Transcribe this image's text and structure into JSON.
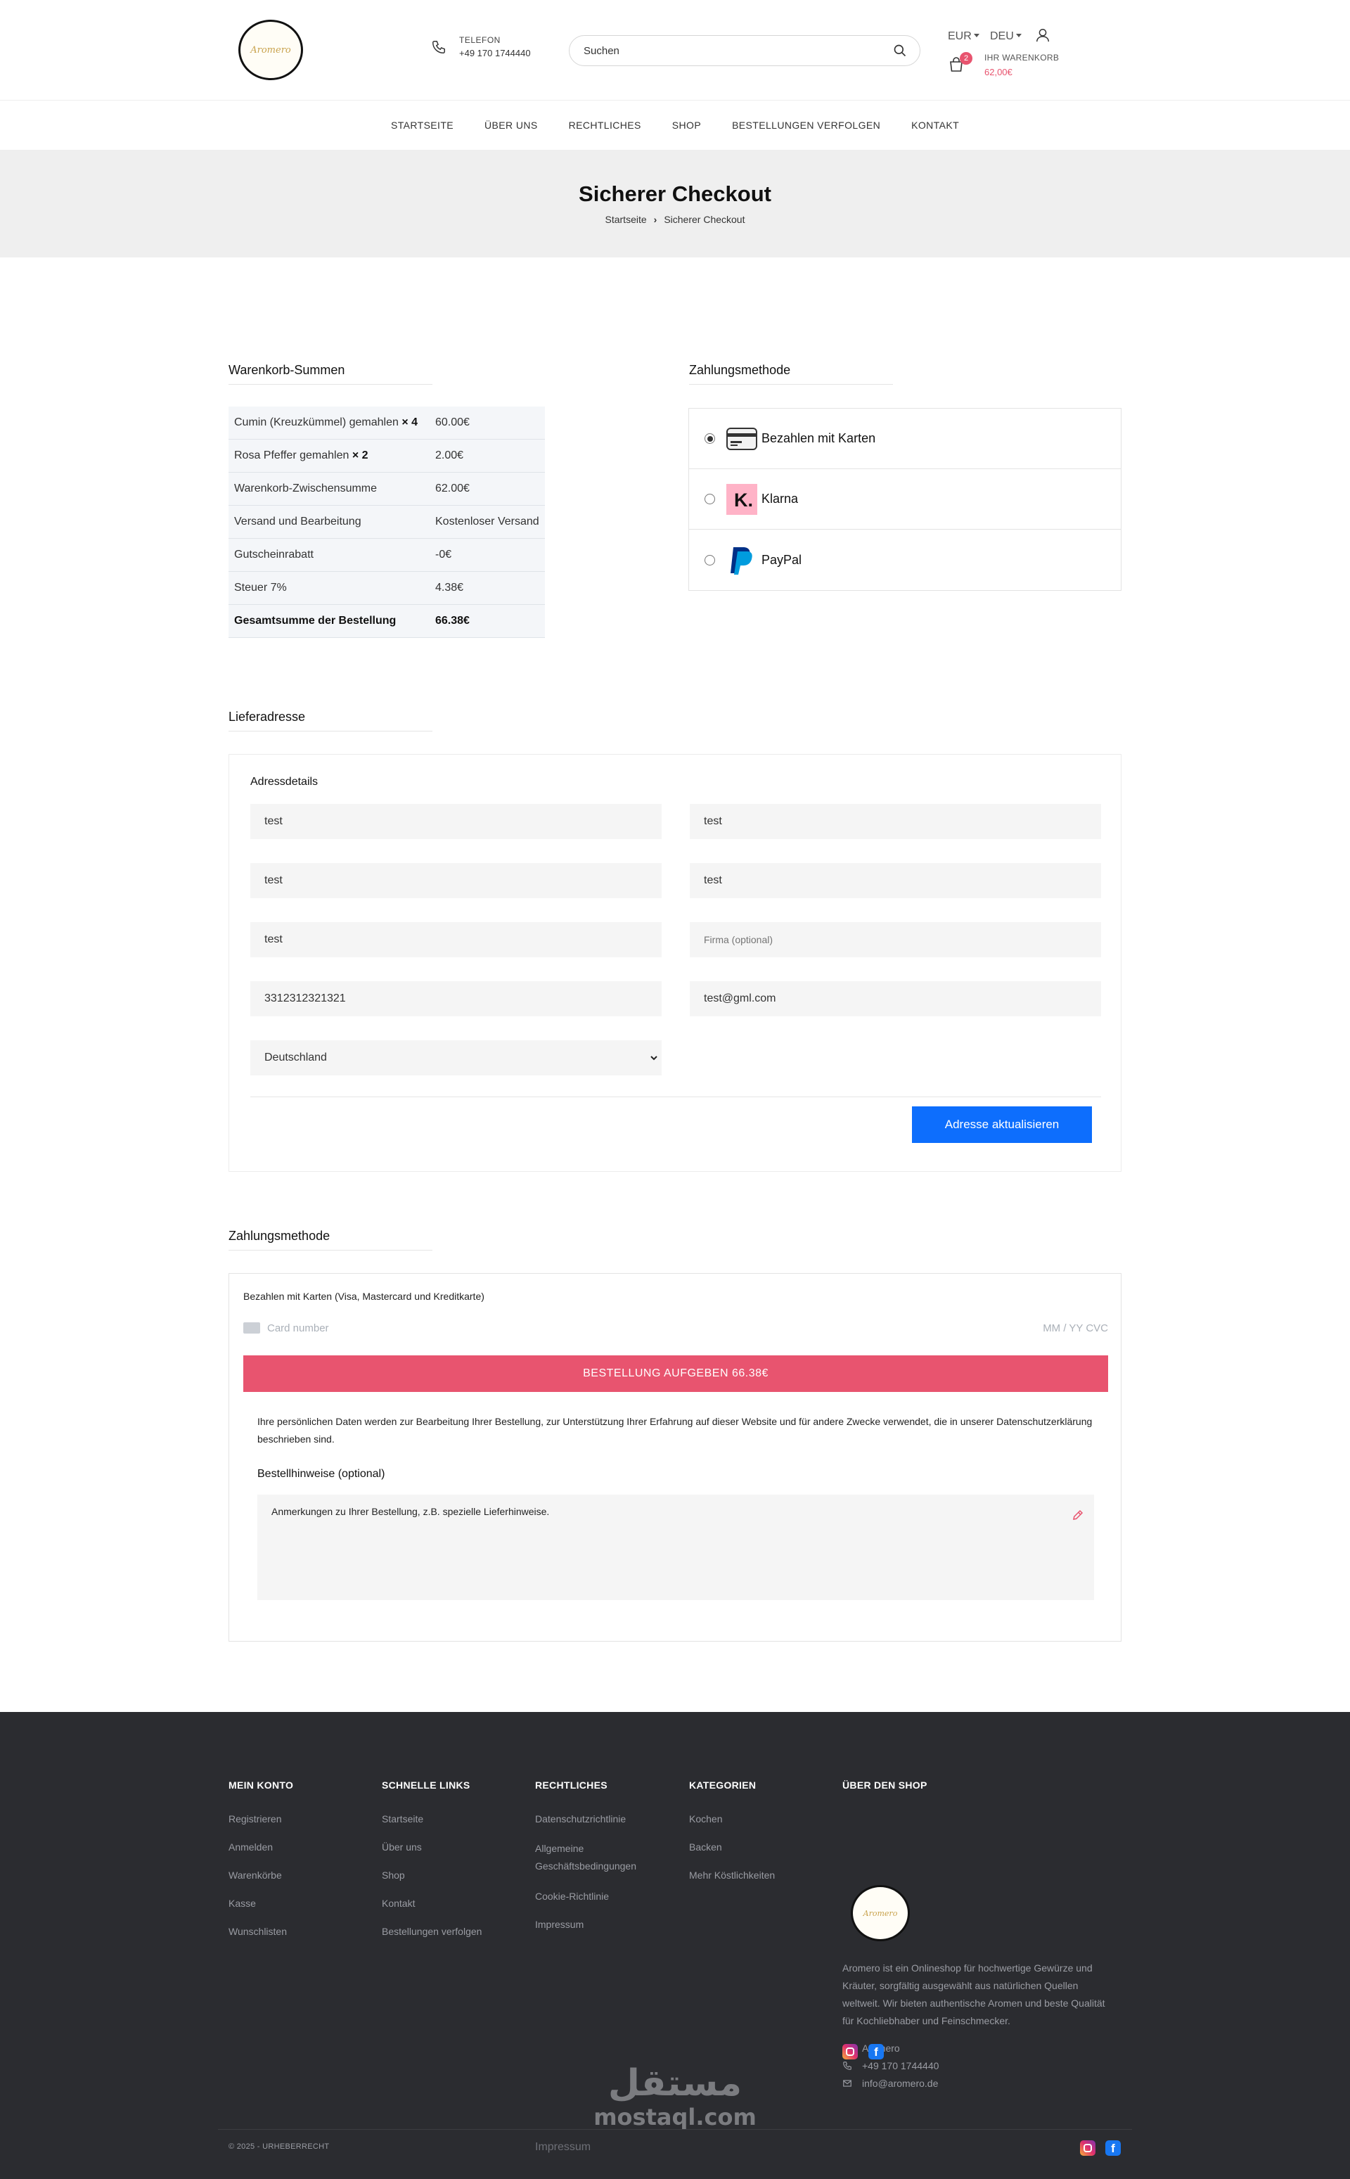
{
  "header": {
    "logo_text": "Aromero",
    "phone_label": "TELEFON",
    "phone_number": "+49 170 1744440",
    "search_placeholder": "Suchen",
    "currency": "EUR",
    "language": "DEU",
    "cart_count": "2",
    "cart_label": "IHR WARENKORB",
    "cart_value": "62,00€"
  },
  "nav": {
    "items": [
      {
        "label": "STARTSEITE"
      },
      {
        "label": "ÜBER UNS"
      },
      {
        "label": "RECHTLICHES"
      },
      {
        "label": "SHOP"
      },
      {
        "label": "BESTELLUNGEN VERFOLGEN"
      },
      {
        "label": "KONTAKT"
      }
    ]
  },
  "page": {
    "title": "Sicherer Checkout",
    "breadcrumb_home": "Startseite",
    "breadcrumb_current": "Sicherer Checkout"
  },
  "totals": {
    "heading": "Warenkorb-Summen",
    "items": [
      {
        "name": "Cumin (Kreuzkümmel) gemahlen",
        "qty": "× 4",
        "price": "60.00€"
      },
      {
        "name": "Rosa Pfeffer gemahlen",
        "qty": "× 2",
        "price": "2.00€"
      }
    ],
    "subtotal_label": "Warenkorb-Zwischensumme",
    "subtotal": "62.00€",
    "shipping_label": "Versand und Bearbeitung",
    "shipping": "Kostenloser Versand",
    "discount_label": "Gutscheinrabatt",
    "discount": "-0€",
    "tax_label": "Steuer 7%",
    "tax": "4.38€",
    "grand_label": "Gesamtsumme der Bestellung",
    "grand": "66.38€"
  },
  "payment_methods": {
    "heading": "Zahlungsmethode",
    "options": [
      {
        "label": "Bezahlen mit Karten",
        "icon": "credit-card-icon",
        "selected": true
      },
      {
        "label": "Klarna",
        "icon": "klarna-icon",
        "selected": false
      },
      {
        "label": "PayPal",
        "icon": "paypal-icon",
        "selected": false
      }
    ]
  },
  "address": {
    "heading": "Lieferadresse",
    "subheading": "Adressdetails",
    "fields": {
      "first_name": "test",
      "last_name": "test",
      "street": "test",
      "city": "test",
      "zip": "test",
      "company_placeholder": "Firma (optional)",
      "phone": "3312312321321",
      "email": "test@gml.com",
      "country": "Deutschland"
    },
    "button": "Adresse aktualisieren"
  },
  "payment": {
    "heading": "Zahlungsmethode",
    "description": "Bezahlen mit Karten (Visa, Mastercard und Kreditkarte)",
    "card_placeholder": "Card number",
    "expiry_cvc_placeholder": "MM / YY  CVC",
    "order_button": "BESTELLUNG AUFGEBEN 66.38€",
    "privacy": "Ihre persönlichen Daten werden zur Bearbeitung Ihrer Bestellung, zur Unterstützung Ihrer Erfahrung auf dieser Website und für andere Zwecke verwendet, die in unserer Datenschutzerklärung beschrieben sind.",
    "notes_label": "Bestellhinweise (optional)",
    "notes_placeholder": "Anmerkungen zu Ihrer Bestellung, z.B. spezielle Lieferhinweise."
  },
  "footer": {
    "columns": [
      {
        "title": "MEIN KONTO",
        "links": [
          "Registrieren",
          "Anmelden",
          "Warenkörbe",
          "Kasse",
          "Wunschlisten"
        ]
      },
      {
        "title": "SCHNELLE LINKS",
        "links": [
          "Startseite",
          "Über uns",
          "Shop",
          "Kontakt",
          "Bestellungen verfolgen"
        ]
      },
      {
        "title": "RECHTLICHES",
        "links": [
          "Datenschutzrichtlinie",
          "Allgemeine Geschäftsbedingungen",
          "Cookie-Richtlinie",
          "Impressum"
        ]
      },
      {
        "title": "KATEGORIEN",
        "links": [
          "Kochen",
          "Backen",
          "Mehr Köstlichkeiten"
        ]
      }
    ],
    "about_title": "ÜBER DEN SHOP",
    "about_text": "Aromero ist ein Onlineshop für hochwertige Gewürze und Kräuter, sorgfältig ausgewählt aus natürlichen Quellen weltweit. Wir bieten authentische Aromen und beste Qualität für Kochliebhaber und Feinschmecker.",
    "contact_name": "Aromero",
    "contact_phone": "+49 170 1744440",
    "contact_email": "info@aromero.de",
    "copyright": "© 2025 - URHEBERRECHT",
    "imprint": "Impressum",
    "watermark_ar": "مستقل",
    "watermark_en": "mostaql.com"
  }
}
